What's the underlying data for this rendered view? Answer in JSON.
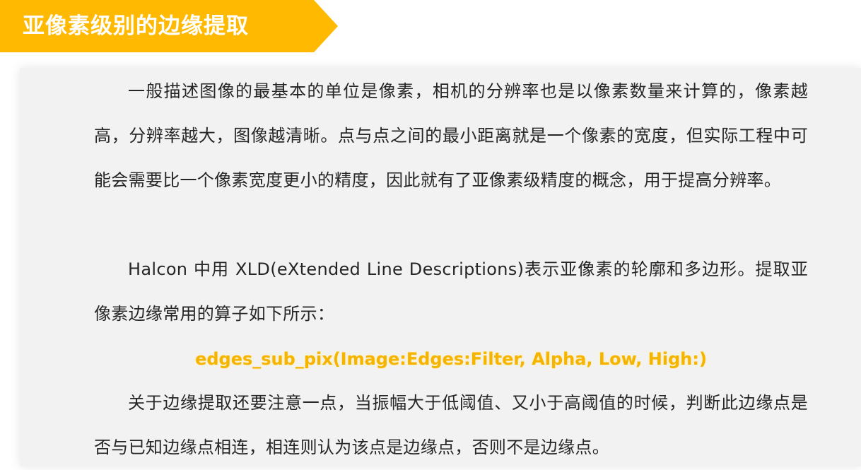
{
  "header": {
    "title": "亚像素级别的边缘提取",
    "banner_color": "#ffb900"
  },
  "content": {
    "paragraph_1": "一般描述图像的最基本的单位是像素，相机的分辨率也是以像素数量来计算的，像素越高，分辨率越大，图像越清晰。点与点之间的最小距离就是一个像素的宽度，但实际工程中可能会需要比一个像素宽度更小的精度，因此就有了亚像素级精度的概念，用于提高分辨率。",
    "paragraph_2": "Halcon 中用 XLD(eXtended Line Descriptions)表示亚像素的轮廓和多边形。提取亚像素边缘常用的算子如下所示：",
    "operator": "edges_sub_pix(Image:Edges:Filter, Alpha, Low, High:)",
    "operator_color": "#f5b400",
    "paragraph_3": "关于边缘提取还要注意一点，当振幅大于低阈值、又小于高阈值的时候，判断此边缘点是否与已知边缘点相连，相连则认为该点是边缘点，否则不是边缘点。"
  }
}
